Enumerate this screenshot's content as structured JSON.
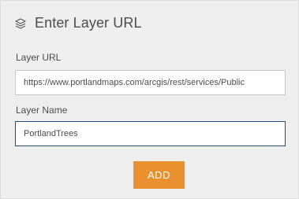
{
  "header": {
    "icon": "layers-icon",
    "title": "Enter Layer URL"
  },
  "layer_url": {
    "label": "Layer URL",
    "value": "https://www.portlandmaps.com/arcgis/rest/services/Public"
  },
  "layer_name": {
    "label": "Layer Name",
    "value": "PortlandTrees"
  },
  "actions": {
    "add_label": "ADD"
  },
  "colors": {
    "panel_bg": "#efefef",
    "button_accent": "#e8912e",
    "focus_border": "#1f4f7a",
    "text": "#4c4c4c"
  }
}
